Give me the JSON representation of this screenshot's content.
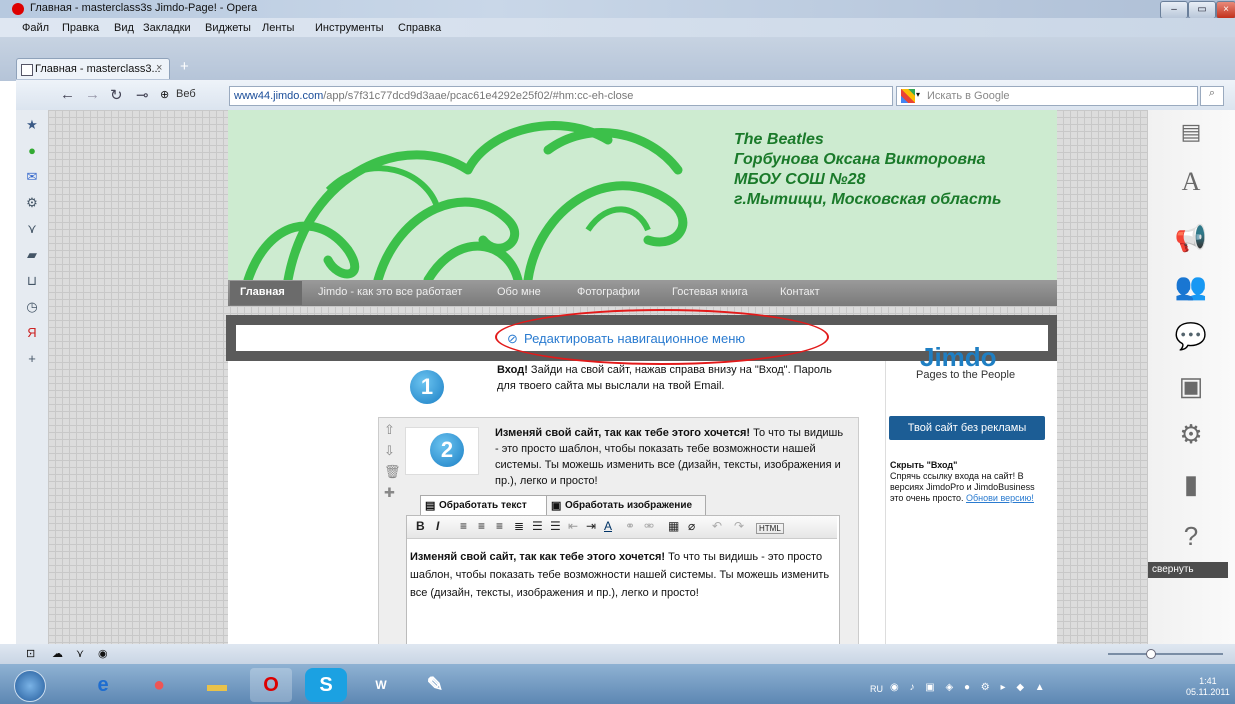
{
  "window": {
    "title": "Главная - masterclass3s Jimdo-Page! - Opera"
  },
  "menu": [
    "Файл",
    "Правка",
    "Вид",
    "Закладки",
    "Виджеты",
    "Ленты",
    "Инструменты",
    "Справка"
  ],
  "tab": {
    "label": "Главная - masterclass3...",
    "close": "×",
    "new": "+"
  },
  "nav": {
    "web_label": "Веб",
    "url_host": "www44.jimdo.com",
    "url_path": "/app/s7f31c77dcd9d3aae/pcac61e4292e25f02/#hm:cc-eh-close",
    "search_placeholder": "Искать в Google"
  },
  "site": {
    "header_lines": [
      "The Beatles",
      "Горбунова Оксана Викторовна",
      "МБОУ СОШ №28",
      "г.Мытищи, Московская область"
    ],
    "nav_items": [
      "Главная",
      "Jimdo - как это все работает",
      "Обо мне",
      "Фотографии",
      "Гостевая книга",
      "Контакт"
    ],
    "edit_nav_link": "Редактировать навигационное меню",
    "step1": {
      "num": "1",
      "bold": "Вход!",
      "text": " Зайди на свой сайт, нажав справа внизу на \"Вход\". Пароль для твоего сайта мы выслали на твой Email."
    },
    "step2": {
      "num": "2",
      "bold": "Изменяй свой сайт, так как тебе этого хочется!",
      "text": " То что ты видишь - это просто шаблон, чтобы показать тебе возможности нашей системы. Ты можешь изменить все (дизайн, тексты, изображения и пр.), легко и просто!"
    },
    "editor_tabs": [
      "Обработать текст",
      "Обработать изображение"
    ],
    "editor_text_bold": "Изменяй свой сайт, так как тебе этого хочется!",
    "editor_text": " То что ты видишь - это просто шаблон, чтобы показать тебе возможности нашей системы. Ты можешь изменить все (дизайн, тексты, изображения и пр.), легко и просто!",
    "jimdo_logo": "Jimdo",
    "jimdo_slogan": "Pages to the People",
    "promo_button": "Твой сайт без рекламы",
    "hide_title": "Скрыть \"Вход\"",
    "hide_text": "Спрячь ссылку входа на сайт! В версиях JimdoPro и JimdoBusiness это очень просто.",
    "hide_link": "Обнови версию!",
    "collapse": "свернуть"
  },
  "taskbar": {
    "lang": "RU",
    "time": "1:41",
    "date": "05.11.2011"
  }
}
